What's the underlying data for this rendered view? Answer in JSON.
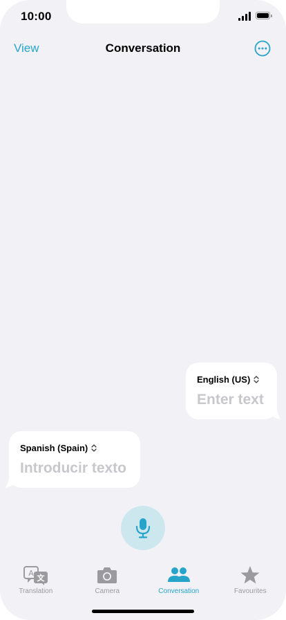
{
  "status_bar": {
    "time": "10:00"
  },
  "nav": {
    "left_label": "View",
    "title": "Conversation",
    "right_icon": "ellipsis-circle-icon"
  },
  "conversation": {
    "right_bubble": {
      "language": "English (US)",
      "placeholder": "Enter text"
    },
    "left_bubble": {
      "language": "Spanish (Spain)",
      "placeholder": "Introducir texto"
    },
    "mic_icon": "microphone-icon"
  },
  "tabs": [
    {
      "label": "Translation",
      "icon": "translation-icon",
      "active": false
    },
    {
      "label": "Camera",
      "icon": "camera-icon",
      "active": false
    },
    {
      "label": "Conversation",
      "icon": "people-icon",
      "active": true
    },
    {
      "label": "Favourites",
      "icon": "star-icon",
      "active": false
    }
  ],
  "colors": {
    "accent": "#27a4c9",
    "background": "#f1f1f6",
    "bubble": "#ffffff",
    "placeholder": "#c7c7cc",
    "inactive_tab": "#9b9b9f",
    "mic_button_bg": "#cde7ef"
  }
}
